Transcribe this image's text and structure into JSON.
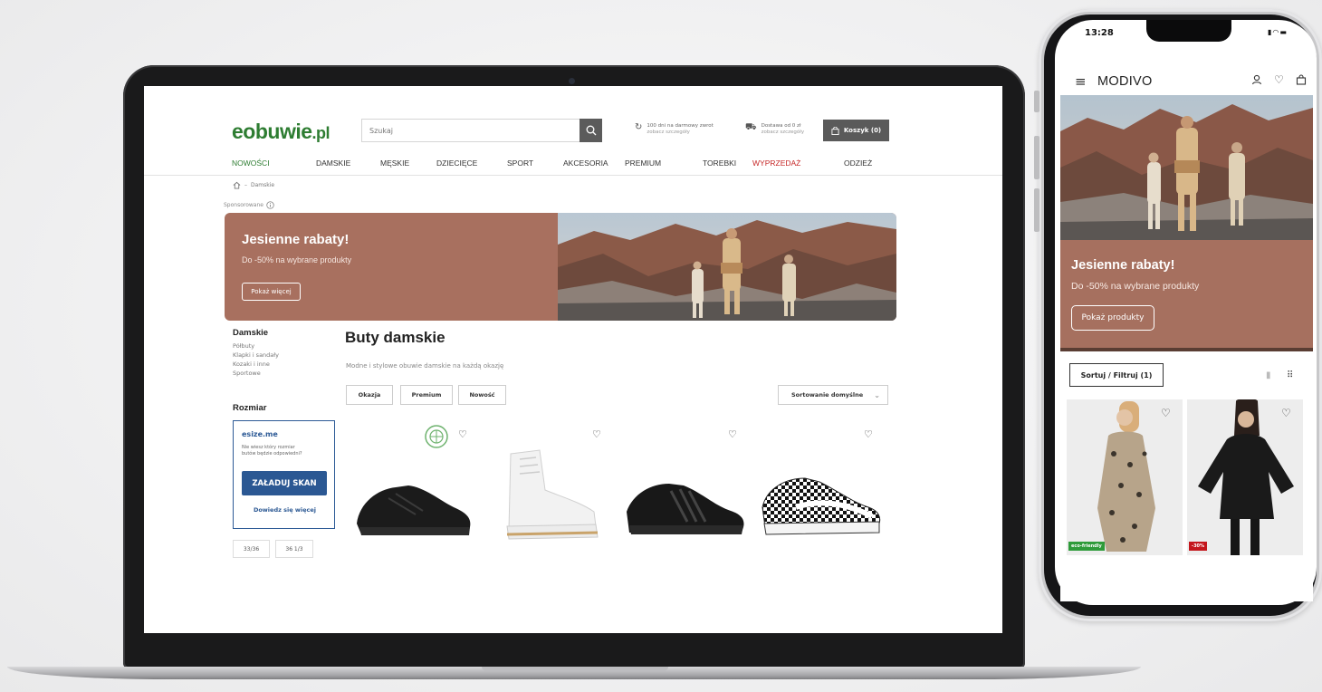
{
  "laptop": {
    "header": {
      "logo_main": "eobuwie",
      "logo_suffix": ".pl",
      "search_placeholder": "Szukaj",
      "returns_line1": "100 dni na darmowy zwrot",
      "returns_line2": "zobacz szczegóły",
      "delivery_line1": "Dostawa od 0 zł",
      "delivery_line2": "zobacz szczegóły",
      "cart_label": "Koszyk (0)"
    },
    "nav": [
      "NOWOŚCI",
      "DAMSKIE",
      "MĘSKIE",
      "DZIECIĘCE",
      "SPORT",
      "AKCESORIA",
      "PREMIUM",
      "TOREBKI",
      "WYPRZEDAŻ",
      "ODZIEŻ"
    ],
    "breadcrumb": "Damskie",
    "sponsored_label": "Sponsorowane",
    "banner": {
      "title": "Jesienne rabaty!",
      "subtitle": "Do -50% na wybrane produkty",
      "button": "Pokaż więcej"
    },
    "sidebar": {
      "heading": "Damskie",
      "items": [
        "Półbuty",
        "Klapki i sandały",
        "Kozaki i inne",
        "Sportowe"
      ],
      "size_heading": "Rozmiar",
      "esize_logo": "esize.me",
      "esize_text": "Nie wiesz który rozmiar butów będzie odpowiedni?",
      "esize_scan": "ZAŁADUJ SKAN",
      "esize_more": "Dowiedz się więcej",
      "sizes": [
        "33/36",
        "36 1/3"
      ]
    },
    "main": {
      "title": "Buty damskie",
      "description": "Modne i stylowe obuwie damskie na każdą okazję",
      "chips": [
        "Okazja",
        "Premium",
        "Nowość"
      ],
      "sort": "Sortowanie domyślne"
    },
    "icons": [
      "home-icon",
      "info-icon",
      "search-icon",
      "return-icon",
      "truck-icon",
      "bag-icon",
      "heart-icon",
      "chevron-down-icon"
    ]
  },
  "phone": {
    "time": "13:28",
    "brand": "MODIVO",
    "banner": {
      "title": "Jesienne rabaty!",
      "subtitle": "Do -50% na wybrane produkty",
      "button": "Pokaż produkty"
    },
    "filter_label": "Sortuj / Filtruj (1)",
    "products": [
      {
        "badge": "eco-friendly",
        "badge_color": "#2e9b3a"
      },
      {
        "badge": "-30%",
        "badge_color": "#c4161c"
      }
    ],
    "icons": [
      "menu-icon",
      "user-icon",
      "heart-icon",
      "bag-icon"
    ]
  },
  "colors": {
    "eobuwie_green": "#2e7d32",
    "banner_brown": "#a8705f",
    "sale_red": "#c62828",
    "esize_blue": "#2b5893"
  }
}
